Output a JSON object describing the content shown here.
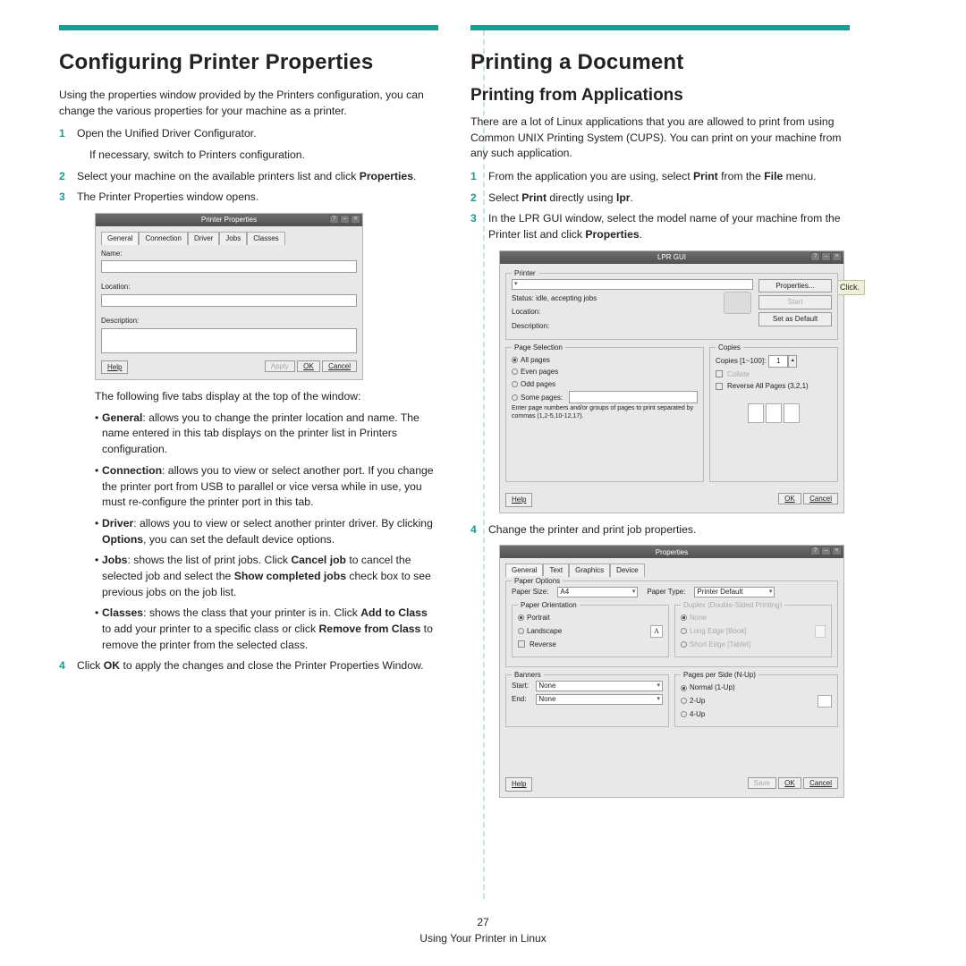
{
  "left": {
    "heading": "Configuring Printer Properties",
    "intro": "Using the properties window provided by the Printers configuration, you can change the various properties for your machine as a printer.",
    "step1": "Open the Unified Driver Configurator.",
    "step1_sub": "If necessary, switch to Printers configuration.",
    "step2a": "Select your machine on the available printers list and click ",
    "step2b": "Properties",
    "step3": "The Printer Properties window opens.",
    "fig1": {
      "title": "Printer Properties",
      "tabs": [
        "General",
        "Connection",
        "Driver",
        "Jobs",
        "Classes"
      ],
      "labels": {
        "name": "Name:",
        "location": "Location:",
        "description": "Description:"
      },
      "btns": {
        "help": "Help",
        "apply": "Apply",
        "ok": "OK",
        "cancel": "Cancel"
      }
    },
    "after_fig": "The following five tabs display at the top of the window:",
    "bul1": {
      "b": "General",
      "t": ": allows you to change the printer location and name. The name entered in this tab displays on the printer list in Printers configuration."
    },
    "bul2": {
      "b": "Connection",
      "t": ": allows you to view or select another port. If you change the printer port from USB to parallel or vice versa while in use, you must re-configure the printer port in this tab."
    },
    "bul3": {
      "b": "Driver",
      "t_a": ": allows you to view or select another printer driver. By clicking ",
      "t_b": "Options",
      "t_c": ", you can set the default device options."
    },
    "bul4": {
      "b": "Jobs",
      "t_a": ": shows the list of print jobs. Click ",
      "t_b": "Cancel job",
      "t_c": " to cancel the selected job and select the ",
      "t_d": "Show completed jobs",
      "t_e": " check box to see previous jobs on the job list."
    },
    "bul5": {
      "b": "Classes",
      "t_a": ": shows the class that your printer is in. Click ",
      "t_b": "Add to Class",
      "t_c": " to add your printer to a specific class or click ",
      "t_d": "Remove from Class",
      "t_e": " to remove the printer from the selected class."
    },
    "step4a": "Click ",
    "step4b": "OK",
    "step4c": " to apply the changes and close the Printer Properties Window."
  },
  "right": {
    "heading": "Printing a Document",
    "sub": "Printing from Applications",
    "intro": "There are a lot of Linux applications that you are allowed to print from using Common UNIX Printing System (CUPS). You can print on your machine from any such application.",
    "s1a": "From the application you are using, select ",
    "s1b": "Print",
    "s1c": " from the ",
    "s1d": "File",
    "s1e": " menu.",
    "s2a": "Select ",
    "s2b": "Print",
    "s2c": " directly using ",
    "s2d": "lpr",
    "s3a": "In the LPR GUI window, select the model name of your machine from the Printer list and click ",
    "s3b": "Properties",
    "click": "Click.",
    "fig2": {
      "title": "LPR GUI",
      "grp_printer": "Printer",
      "status": "Status: idle, accepting jobs",
      "loc": "Location:",
      "desc": "Description:",
      "props": "Properties...",
      "start": "Start",
      "def": "Set as Default",
      "grp_ps": "Page Selection",
      "r1": "All pages",
      "r2": "Even pages",
      "r3": "Odd pages",
      "r4": "Some pages:",
      "note": "Enter page numbers and/or groups of pages to print separated by commas (1,2-5,10-12,17).",
      "grp_c": "Copies",
      "copies": "Copies [1~100]:",
      "cval": "1",
      "collate": "Collate",
      "rev": "Reverse All Pages (3,2,1)",
      "help": "Help",
      "ok": "OK",
      "cancel": "Cancel"
    },
    "s4": "Change the printer and print job properties.",
    "fig3": {
      "title": "Properties",
      "tabs": [
        "General",
        "Text",
        "Graphics",
        "Device"
      ],
      "grp_po": "Paper Options",
      "psize": "Paper Size:",
      "a4": "A4",
      "ptype": "Paper Type:",
      "pdef": "Printer Default",
      "grp_or": "Paper Orientation",
      "portrait": "Portrait",
      "landscape": "Landscape",
      "reverse": "Reverse",
      "grp_dup": "Duplex (Double-Sided Printing)",
      "none": "None",
      "long": "Long Edge [Book]",
      "short": "Short Edge [Tablet]",
      "grp_ban": "Banners",
      "start": "Start:",
      "end": "End:",
      "noneval": "None",
      "grp_nup": "Pages per Side (N-Up)",
      "n1": "Normal (1-Up)",
      "n2": "2-Up",
      "n4": "4-Up",
      "help": "Help",
      "save": "Save",
      "ok": "OK",
      "cancel": "Cancel"
    }
  },
  "footer": {
    "page": "27",
    "title": "Using Your Printer in Linux"
  }
}
